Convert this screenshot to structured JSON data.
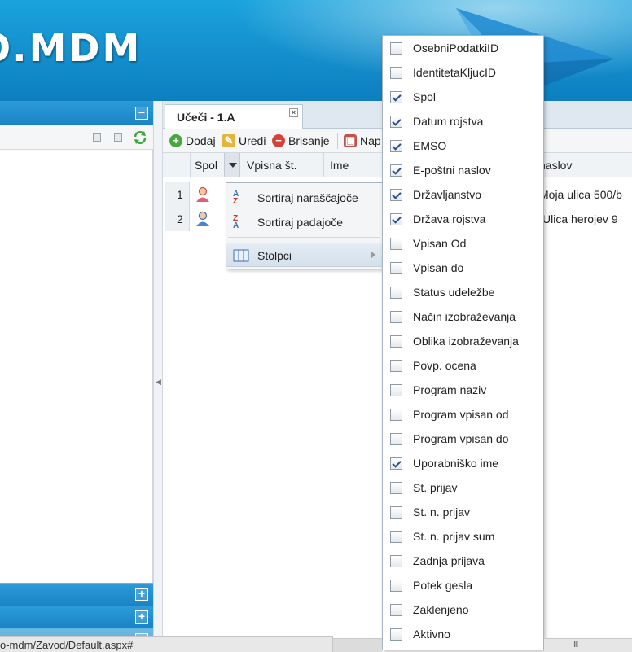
{
  "app": {
    "logo_text": "O.MDM"
  },
  "left_panel": {
    "collapse_icon": "minus-box-icon",
    "refresh_icon": "refresh-icon",
    "sections_icon": "plus-box-icon"
  },
  "tab": {
    "title": "Učeči - 1.A"
  },
  "toolbar": {
    "add_label": "Dodaj",
    "edit_label": "Uredi",
    "delete_label": "Brisanje",
    "more_label": "Nap"
  },
  "grid": {
    "columns": [
      "Spol",
      "Vpisna št.",
      "Ime",
      "naslov"
    ],
    "rows": [
      {
        "num": "1",
        "gender": "female",
        "address": "Moja ulica 500/b"
      },
      {
        "num": "2",
        "gender": "male",
        "address": "Ulica herojev 9"
      }
    ]
  },
  "context_menu": {
    "sort_asc": "Sortiraj naraščajoče",
    "sort_desc": "Sortiraj padajoče",
    "columns": "Stolpci"
  },
  "columns_menu": {
    "items": [
      {
        "label": "OsebniPodatkiID",
        "checked": false
      },
      {
        "label": "IdentitetaKljucID",
        "checked": false
      },
      {
        "label": "Spol",
        "checked": true
      },
      {
        "label": "Datum rojstva",
        "checked": true
      },
      {
        "label": "EMSO",
        "checked": true
      },
      {
        "label": "E-poštni naslov",
        "checked": true
      },
      {
        "label": "Državljanstvo",
        "checked": true
      },
      {
        "label": "Država rojstva",
        "checked": true
      },
      {
        "label": "Vpisan Od",
        "checked": false
      },
      {
        "label": "Vpisan do",
        "checked": false
      },
      {
        "label": "Status udeležbe",
        "checked": false
      },
      {
        "label": "Način izobraževanja",
        "checked": false
      },
      {
        "label": "Oblika izobraževanja",
        "checked": false
      },
      {
        "label": "Povp. ocena",
        "checked": false
      },
      {
        "label": "Program naziv",
        "checked": false
      },
      {
        "label": "Program vpisan od",
        "checked": false
      },
      {
        "label": "Program vpisan do",
        "checked": false
      },
      {
        "label": "Uporabniško ime",
        "checked": true
      },
      {
        "label": "St. prijav",
        "checked": false
      },
      {
        "label": "St. n. prijav",
        "checked": false
      },
      {
        "label": "St. n. prijav sum",
        "checked": false
      },
      {
        "label": "Zadnja prijava",
        "checked": false
      },
      {
        "label": "Potek gesla",
        "checked": false
      },
      {
        "label": "Zaklenjeno",
        "checked": false
      },
      {
        "label": "Aktivno",
        "checked": false
      }
    ]
  },
  "statusbar": {
    "url": "o-mdm/Zavod/Default.aspx#"
  },
  "colors": {
    "header_blue": "#1592cf",
    "panel_blue": "#1a83c4",
    "check_blue": "#2b4f8c"
  }
}
